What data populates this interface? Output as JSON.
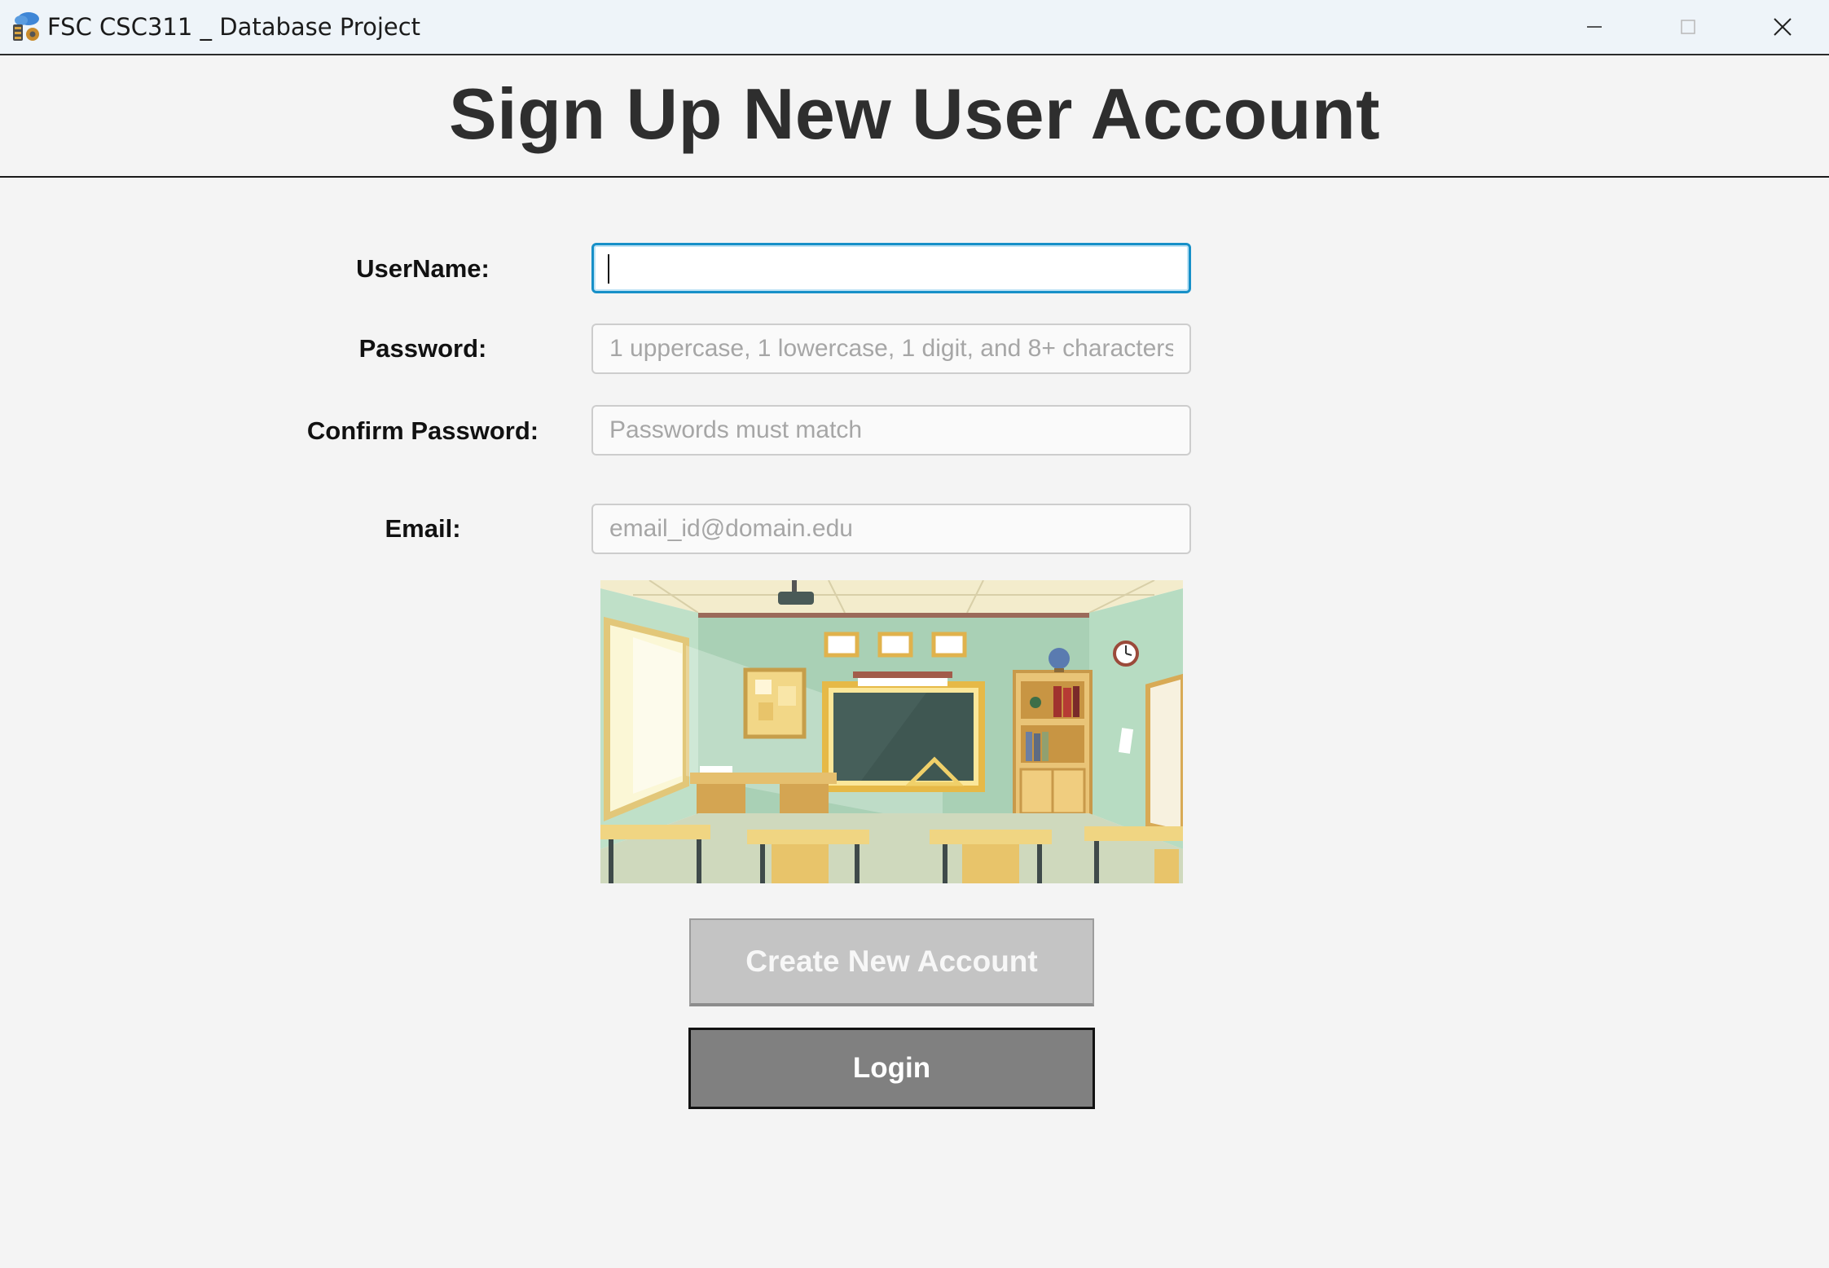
{
  "window": {
    "title": "FSC CSC311 _ Database Project",
    "app_icon": "database-cloud-icon",
    "controls": [
      "minimize-icon",
      "maximize-icon",
      "close-icon"
    ]
  },
  "page": {
    "title": "Sign Up New User Account"
  },
  "form": {
    "username": {
      "label": "UserName:",
      "value": "",
      "placeholder": "",
      "focused": true
    },
    "password": {
      "label": "Password:",
      "value": "",
      "placeholder": "1 uppercase, 1 lowercase, 1 digit, and 8+ characters"
    },
    "confirm_password": {
      "label": "Confirm Password:",
      "value": "",
      "placeholder": "Passwords must match"
    },
    "email": {
      "label": "Email:",
      "value": "",
      "placeholder": "email_id@domain.edu"
    }
  },
  "illustration": {
    "subject": "classroom-illustration"
  },
  "buttons": {
    "create_account": {
      "label": "Create New Account",
      "enabled": false
    },
    "login": {
      "label": "Login"
    }
  },
  "colors": {
    "background": "#f4f4f4",
    "focus_accent": "#1790c8",
    "create_button": "#c4c4c4",
    "login_button": "#808080"
  }
}
